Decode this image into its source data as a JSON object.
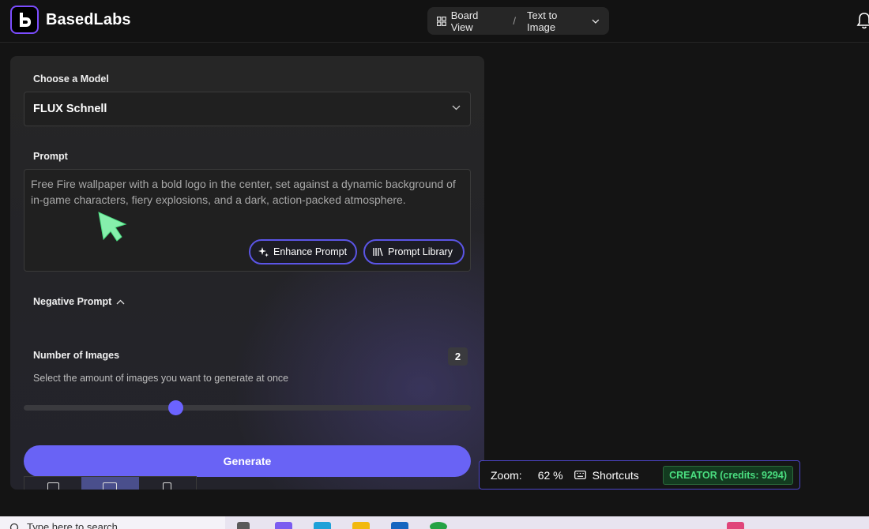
{
  "header": {
    "brand": "BasedLabs",
    "breadcrumb": {
      "board_view": "Board View",
      "separator": "/",
      "current": "Text to Image"
    },
    "notification_icon": "bell-icon"
  },
  "panel": {
    "model_label": "Choose a Model",
    "model_selected": "FLUX Schnell",
    "prompt_label": "Prompt",
    "prompt_text": "Free Fire wallpaper with a bold logo in the center, set against a dynamic background of in-game characters, fiery explosions, and a dark, action-packed atmosphere.",
    "enhance_label": "Enhance Prompt",
    "library_label": "Prompt Library",
    "negative_label": "Negative Prompt",
    "num_images_label": "Number of Images",
    "num_images_value": "2",
    "num_images_help": "Select the amount of images you want to generate at once",
    "slider_fraction": 0.34,
    "generate_label": "Generate"
  },
  "zoombar": {
    "zoom_label": "Zoom:",
    "zoom_value": "62 %",
    "shortcuts_label": "Shortcuts",
    "credits": "CREATOR (credits: 9294)"
  },
  "taskbar": {
    "search_placeholder": "Type here to search"
  },
  "colors": {
    "accent": "#6963f5",
    "credits_green": "#4ade80",
    "background": "#141414"
  }
}
